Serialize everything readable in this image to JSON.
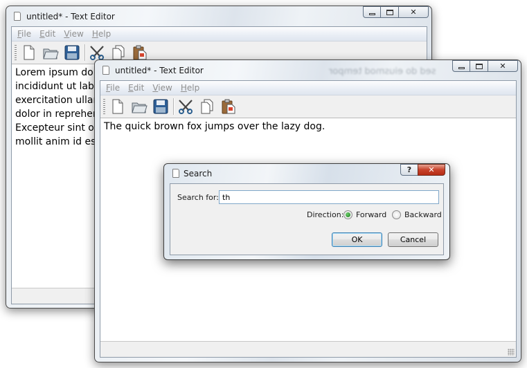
{
  "back_window": {
    "title": "untitled* - Text Editor",
    "menu": [
      {
        "label": "File",
        "mnemonic": "F",
        "rest": "ile"
      },
      {
        "label": "Edit",
        "mnemonic": "E",
        "rest": "dit"
      },
      {
        "label": "View",
        "mnemonic": "V",
        "rest": "iew"
      },
      {
        "label": "Help",
        "mnemonic": "H",
        "rest": "elp"
      }
    ],
    "lines": [
      "Lorem ipsum dolor sit amet, consectetur adipisicing elit, sed do eiusmod tempor",
      "incididunt ut labore et dolore magna aliqua. Ut enim ad minim veniam, quis nostrud",
      "exercitation ullamco laboris nisi ut aliquip ex ea commodo consequat. Duis aute irure",
      "dolor in reprehenderit in voluptate velit esse cillum dolore eu fugiat nulla pariatur.",
      "Excepteur sint occaecat cupidatat non proident, sunt in culpa qui officia deserunt",
      "mollit anim id est laborum."
    ],
    "ghost_text": "sed do eiusmod tempor"
  },
  "front_window": {
    "title": "untitled* - Text Editor",
    "menu": [
      {
        "label": "File",
        "mnemonic": "F",
        "rest": "ile"
      },
      {
        "label": "Edit",
        "mnemonic": "E",
        "rest": "dit"
      },
      {
        "label": "View",
        "mnemonic": "V",
        "rest": "iew"
      },
      {
        "label": "Help",
        "mnemonic": "H",
        "rest": "elp"
      }
    ],
    "text": "The quick brown fox jumps over the lazy dog."
  },
  "toolbar": {
    "icons": [
      "new-file-icon",
      "open-folder-icon",
      "save-icon",
      "cut-icon",
      "copy-icon",
      "paste-icon"
    ]
  },
  "search_dialog": {
    "title": "Search",
    "help_label": "?",
    "search_for_label": "Search for:",
    "search_value": "th",
    "direction_label": "Direction:",
    "forward_label": "Forward",
    "backward_label": "Backward",
    "direction_selected": "Forward",
    "ok_label": "OK",
    "cancel_label": "Cancel"
  },
  "colors": {
    "selected_radio": "#1f8f1f",
    "close_button": "#c7422b",
    "default_button_border": "#3c7fb1"
  }
}
